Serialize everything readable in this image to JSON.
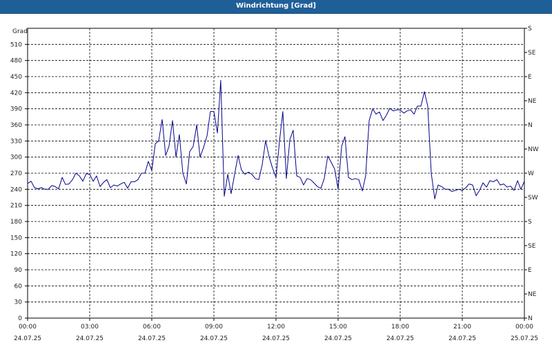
{
  "window": {
    "title": "Windrichtung [Grad]"
  },
  "chart_data": {
    "type": "line",
    "title": "Windrichtung [Grad]",
    "ylabel": "Grad",
    "xlabel": "",
    "ylim": [
      0,
      540
    ],
    "xlim_hours": [
      0,
      24
    ],
    "grid": true,
    "y_ticks": [
      0,
      30,
      60,
      90,
      120,
      150,
      180,
      210,
      240,
      270,
      300,
      330,
      360,
      390,
      420,
      450,
      480,
      510
    ],
    "y2_ticks": [
      {
        "value": 0,
        "label": "N"
      },
      {
        "value": 45,
        "label": "NE"
      },
      {
        "value": 90,
        "label": "E"
      },
      {
        "value": 135,
        "label": "SE"
      },
      {
        "value": 180,
        "label": "S"
      },
      {
        "value": 225,
        "label": "SW"
      },
      {
        "value": 270,
        "label": "W"
      },
      {
        "value": 315,
        "label": "NW"
      },
      {
        "value": 360,
        "label": "N"
      },
      {
        "value": 405,
        "label": "NE"
      },
      {
        "value": 450,
        "label": "E"
      },
      {
        "value": 495,
        "label": "SE"
      },
      {
        "value": 540,
        "label": "S"
      }
    ],
    "x_ticks": [
      {
        "hour": 0,
        "time": "00:00",
        "date": "24.07.25"
      },
      {
        "hour": 3,
        "time": "03:00",
        "date": "24.07.25"
      },
      {
        "hour": 6,
        "time": "06:00",
        "date": "24.07.25"
      },
      {
        "hour": 9,
        "time": "09:00",
        "date": "24.07.25"
      },
      {
        "hour": 12,
        "time": "12:00",
        "date": "24.07.25"
      },
      {
        "hour": 15,
        "time": "15:00",
        "date": "24.07.25"
      },
      {
        "hour": 18,
        "time": "18:00",
        "date": "24.07.25"
      },
      {
        "hour": 21,
        "time": "21:00",
        "date": "24.07.25"
      },
      {
        "hour": 24,
        "time": "00:00",
        "date": "25.07.25"
      }
    ],
    "series": [
      {
        "color": "#00008b",
        "points": [
          [
            0.0,
            251
          ],
          [
            0.17,
            255
          ],
          [
            0.33,
            243
          ],
          [
            0.5,
            241
          ],
          [
            0.67,
            243
          ],
          [
            0.83,
            240
          ],
          [
            1.0,
            240
          ],
          [
            1.17,
            247
          ],
          [
            1.33,
            245
          ],
          [
            1.5,
            241
          ],
          [
            1.67,
            262
          ],
          [
            1.83,
            249
          ],
          [
            2.0,
            250
          ],
          [
            2.17,
            258
          ],
          [
            2.33,
            270
          ],
          [
            2.5,
            265
          ],
          [
            2.67,
            255
          ],
          [
            2.83,
            269
          ],
          [
            3.0,
            268
          ],
          [
            3.17,
            255
          ],
          [
            3.33,
            265
          ],
          [
            3.5,
            245
          ],
          [
            3.67,
            253
          ],
          [
            3.83,
            258
          ],
          [
            4.0,
            243
          ],
          [
            4.17,
            248
          ],
          [
            4.33,
            246
          ],
          [
            4.5,
            250
          ],
          [
            4.67,
            253
          ],
          [
            4.83,
            242
          ],
          [
            5.0,
            254
          ],
          [
            5.17,
            254
          ],
          [
            5.33,
            258
          ],
          [
            5.5,
            270
          ],
          [
            5.67,
            270
          ],
          [
            5.83,
            292
          ],
          [
            6.0,
            275
          ],
          [
            6.17,
            325
          ],
          [
            6.33,
            330
          ],
          [
            6.5,
            370
          ],
          [
            6.67,
            303
          ],
          [
            6.83,
            320
          ],
          [
            7.0,
            368
          ],
          [
            7.17,
            300
          ],
          [
            7.33,
            342
          ],
          [
            7.5,
            270
          ],
          [
            7.67,
            250
          ],
          [
            7.83,
            310
          ],
          [
            8.0,
            320
          ],
          [
            8.17,
            360
          ],
          [
            8.33,
            300
          ],
          [
            8.5,
            318
          ],
          [
            8.67,
            340
          ],
          [
            8.83,
            385
          ],
          [
            9.0,
            385
          ],
          [
            9.17,
            345
          ],
          [
            9.33,
            443
          ],
          [
            9.5,
            227
          ],
          [
            9.67,
            268
          ],
          [
            9.83,
            232
          ],
          [
            10.0,
            268
          ],
          [
            10.17,
            303
          ],
          [
            10.33,
            276
          ],
          [
            10.5,
            268
          ],
          [
            10.67,
            272
          ],
          [
            10.83,
            268
          ],
          [
            11.0,
            260
          ],
          [
            11.17,
            258
          ],
          [
            11.33,
            285
          ],
          [
            11.5,
            331
          ],
          [
            11.67,
            300
          ],
          [
            11.83,
            280
          ],
          [
            12.0,
            262
          ],
          [
            12.17,
            330
          ],
          [
            12.33,
            385
          ],
          [
            12.5,
            260
          ],
          [
            12.67,
            333
          ],
          [
            12.83,
            350
          ],
          [
            13.0,
            265
          ],
          [
            13.17,
            262
          ],
          [
            13.33,
            248
          ],
          [
            13.5,
            260
          ],
          [
            13.67,
            258
          ],
          [
            13.83,
            252
          ],
          [
            14.0,
            245
          ],
          [
            14.17,
            242
          ],
          [
            14.33,
            260
          ],
          [
            14.5,
            302
          ],
          [
            14.67,
            290
          ],
          [
            14.83,
            278
          ],
          [
            15.0,
            240
          ],
          [
            15.17,
            320
          ],
          [
            15.33,
            338
          ],
          [
            15.5,
            262
          ],
          [
            15.67,
            258
          ],
          [
            15.83,
            260
          ],
          [
            16.0,
            258
          ],
          [
            16.17,
            237
          ],
          [
            16.33,
            265
          ],
          [
            16.5,
            368
          ],
          [
            16.67,
            390
          ],
          [
            16.83,
            380
          ],
          [
            17.0,
            384
          ],
          [
            17.17,
            368
          ],
          [
            17.33,
            378
          ],
          [
            17.5,
            391
          ],
          [
            17.67,
            386
          ],
          [
            17.83,
            388
          ],
          [
            18.0,
            388
          ],
          [
            18.17,
            382
          ],
          [
            18.33,
            386
          ],
          [
            18.5,
            388
          ],
          [
            18.67,
            380
          ],
          [
            18.83,
            395
          ],
          [
            19.0,
            395
          ],
          [
            19.17,
            422
          ],
          [
            19.33,
            395
          ],
          [
            19.5,
            270
          ],
          [
            19.67,
            222
          ],
          [
            19.83,
            248
          ],
          [
            20.0,
            245
          ],
          [
            20.17,
            240
          ],
          [
            20.33,
            240
          ],
          [
            20.5,
            236
          ],
          [
            20.67,
            238
          ],
          [
            20.83,
            240
          ],
          [
            21.0,
            238
          ],
          [
            21.17,
            243
          ],
          [
            21.33,
            250
          ],
          [
            21.5,
            248
          ],
          [
            21.67,
            228
          ],
          [
            21.83,
            238
          ],
          [
            22.0,
            252
          ],
          [
            22.17,
            244
          ],
          [
            22.33,
            256
          ],
          [
            22.5,
            254
          ],
          [
            22.67,
            258
          ],
          [
            22.83,
            248
          ],
          [
            23.0,
            250
          ],
          [
            23.17,
            244
          ],
          [
            23.33,
            246
          ],
          [
            23.5,
            238
          ],
          [
            23.67,
            256
          ],
          [
            23.83,
            240
          ],
          [
            24.0,
            255
          ]
        ]
      }
    ]
  }
}
